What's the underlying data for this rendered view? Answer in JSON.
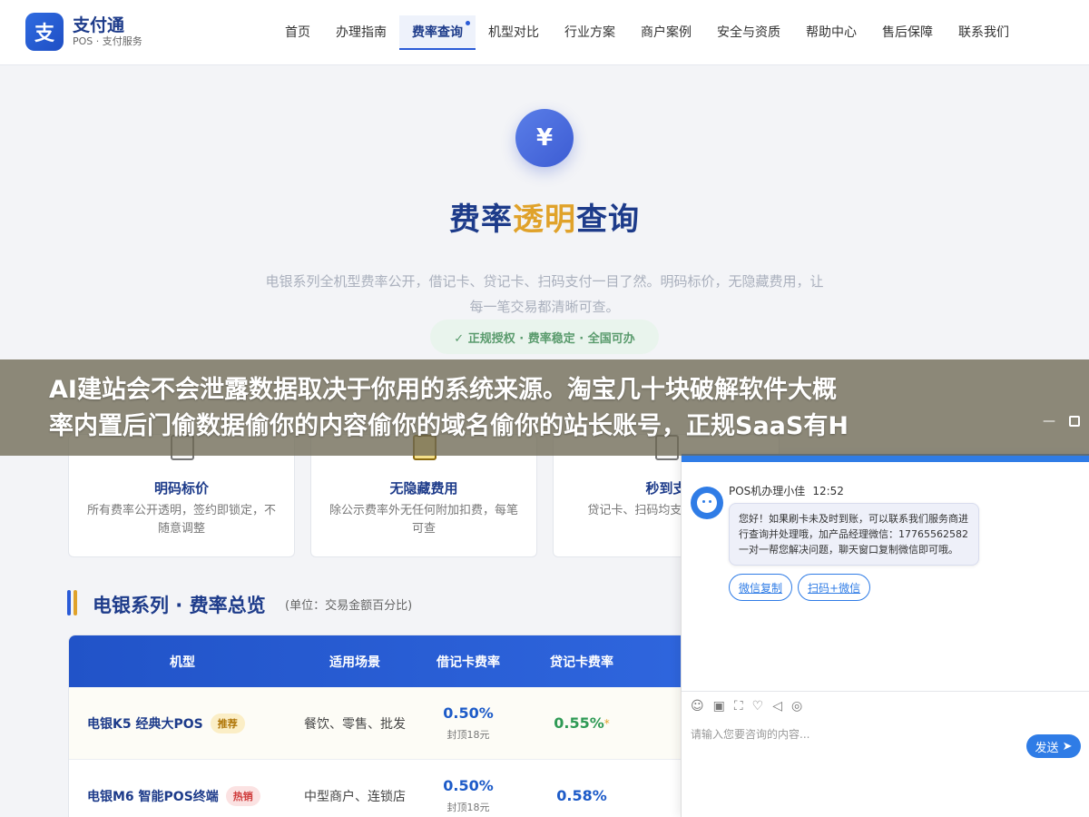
{
  "brand": {
    "mark": "支",
    "title": "支付通",
    "subtitle": "POS · 支付服务",
    "primary_color": "#1d3b8a",
    "accent_color": "#e0a22a"
  },
  "nav": {
    "items": [
      {
        "label": "首页"
      },
      {
        "label": "办理指南"
      },
      {
        "label": "费率查询",
        "active": true
      },
      {
        "label": "机型对比"
      },
      {
        "label": "行业方案"
      },
      {
        "label": "商户案例"
      },
      {
        "label": "安全与资质"
      },
      {
        "label": "帮助中心"
      },
      {
        "label": "售后保障"
      },
      {
        "label": "联系我们"
      }
    ]
  },
  "hero": {
    "icon": "¥",
    "title_part1": "费率",
    "title_accent": "透明",
    "title_part2": "查询",
    "description": "电银系列全机型费率公开，借记卡、贷记卡、扫码支付一目了然。明码标价，无隐藏费用，让每一笔交易都清晰可查。",
    "badge": "✓ 正规授权 · 费率稳定 · 全国可办"
  },
  "banner": {
    "text_line1": "AI建站会不会泄露数据取决于你用的系统来源。淘宝几十块破解软件大概",
    "text_line2": "率内置后门偷数据偷你的内容偷你的域名偷你的站长账号，正规SaaS有H"
  },
  "cards": [
    {
      "title": "明码标价",
      "desc": "所有费率公开透明，签约即锁定，不随意调整",
      "icon": "document-icon"
    },
    {
      "title": "无隐藏费用",
      "desc": "除公示费率外无任何附加扣费，每笔可查",
      "icon": "shield-icon"
    },
    {
      "title": "秒到支",
      "desc": "贷记卡、扫码均支持 资金周转",
      "icon": "clock-icon"
    }
  ],
  "section": {
    "title": "电银系列 · 费率总览",
    "unit": "(单位：交易金额百分比)"
  },
  "table": {
    "headers": [
      "机型",
      "适用场景",
      "借记卡费率",
      "贷记卡费率"
    ],
    "rows": [
      {
        "model": "电银K5 经典大POS",
        "tag": "推荐",
        "scene": "餐饮、零售、批发",
        "debit": "0.50%",
        "debit_cap": "封顶18元",
        "credit": "0.55%",
        "credit_star": "*"
      },
      {
        "model": "电银M6 智能POS终端",
        "tag": "热销",
        "scene": "中型商户、连锁店",
        "debit": "0.50%",
        "debit_cap": "封顶18元",
        "credit": "0.58%",
        "credit_star": ""
      }
    ]
  },
  "chat": {
    "agent": "POS机办理小佳",
    "time": "12:52",
    "message": "您好！如果刷卡未及时到账，可以联系我们服务商进行查询并处理哦，加产品经理微信：17765562582 一对一帮您解决问题，聊天窗口复制微信即可哦。",
    "buttons": [
      "微信复制",
      "扫码+微信"
    ],
    "placeholder": "请输入您要咨询的内容...",
    "send": "发送",
    "minimize": "—"
  }
}
